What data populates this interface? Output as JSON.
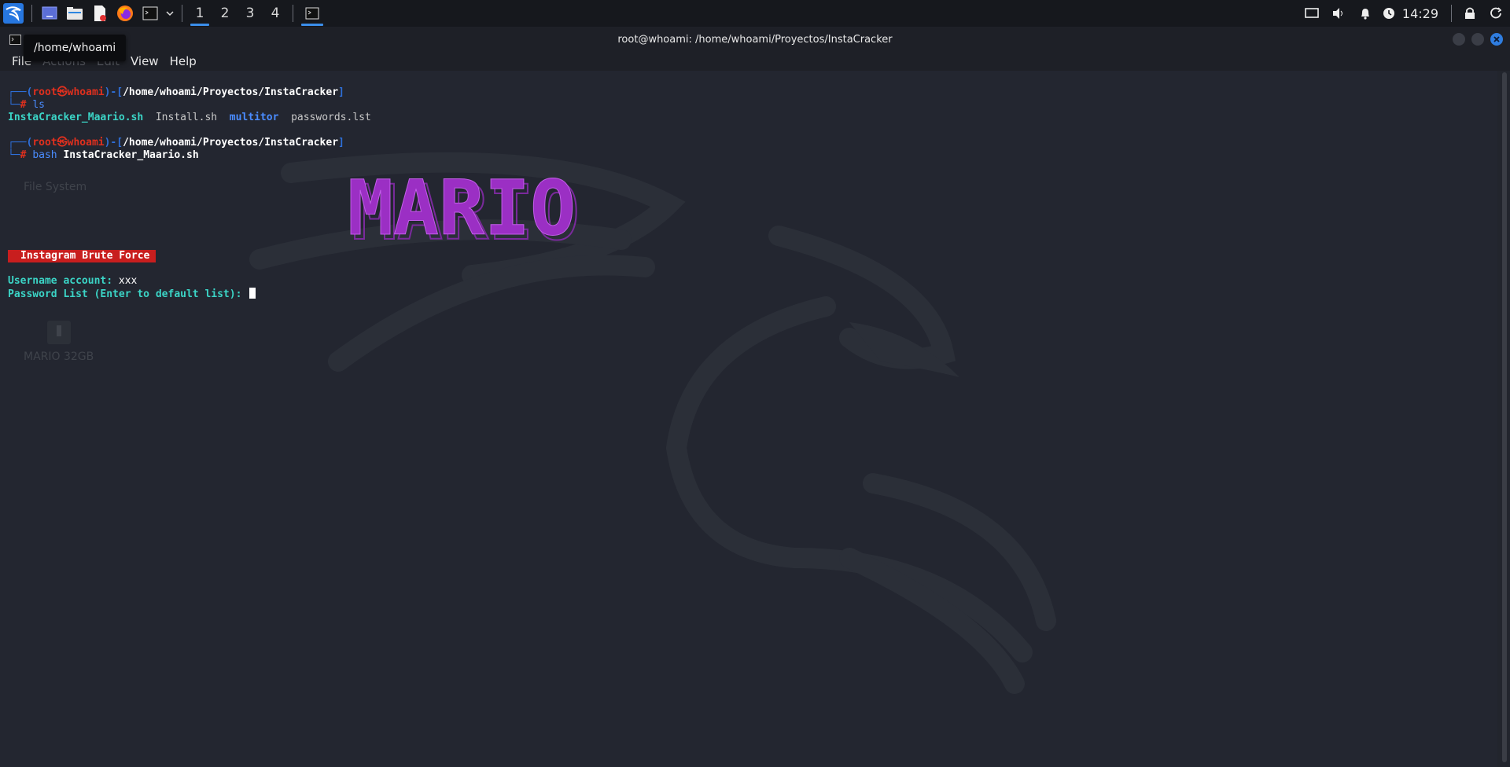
{
  "panel": {
    "workspaces": [
      "1",
      "2",
      "3",
      "4"
    ],
    "clock": "14:29"
  },
  "window": {
    "title": "root@whoami: /home/whoami/Proyectos/InstaCracker",
    "tooltip": "/home/whoami"
  },
  "menu": {
    "file": "File",
    "actions": "Actions",
    "edit": "Edit",
    "view": "View",
    "help": "Help"
  },
  "desktop": {
    "file_system_label": "File System",
    "drive_label": "MARIO 32GB"
  },
  "terminal": {
    "prompt1": {
      "corner_top": "┌──(",
      "user": "root",
      "at": "㉿",
      "host": "whoami",
      "mid": ")-[",
      "path": "/home/whoami/Proyectos/InstaCracker",
      "close": "]",
      "corner_bottom": "└─",
      "hash": "#",
      "command": "ls"
    },
    "ls_output": [
      "InstaCracker_Maario.sh",
      "Install.sh",
      "multitor",
      "passwords.lst"
    ],
    "prompt2": {
      "corner_top": "┌──(",
      "user": "root",
      "at": "㉿",
      "host": "whoami",
      "mid": ")-[",
      "path": "/home/whoami/Proyectos/InstaCracker",
      "close": "]",
      "corner_bottom": "└─",
      "hash": "#",
      "command": "bash",
      "argument": "InstaCracker_Maario.sh"
    },
    "ascii_art": "MARIO",
    "banner": "Instagram Brute Force",
    "username_label": "Username account:",
    "username_value": "xxx",
    "password_label": "Password List (Enter to default list):"
  },
  "colors": {
    "accent": "#3b8eea",
    "art_purple": "#9b2fc4",
    "banner_red": "#c81e1e",
    "prompt_blue": "#2e6fd9",
    "prompt_red": "#e0301e",
    "ls_cyan": "#3bd4c6"
  }
}
